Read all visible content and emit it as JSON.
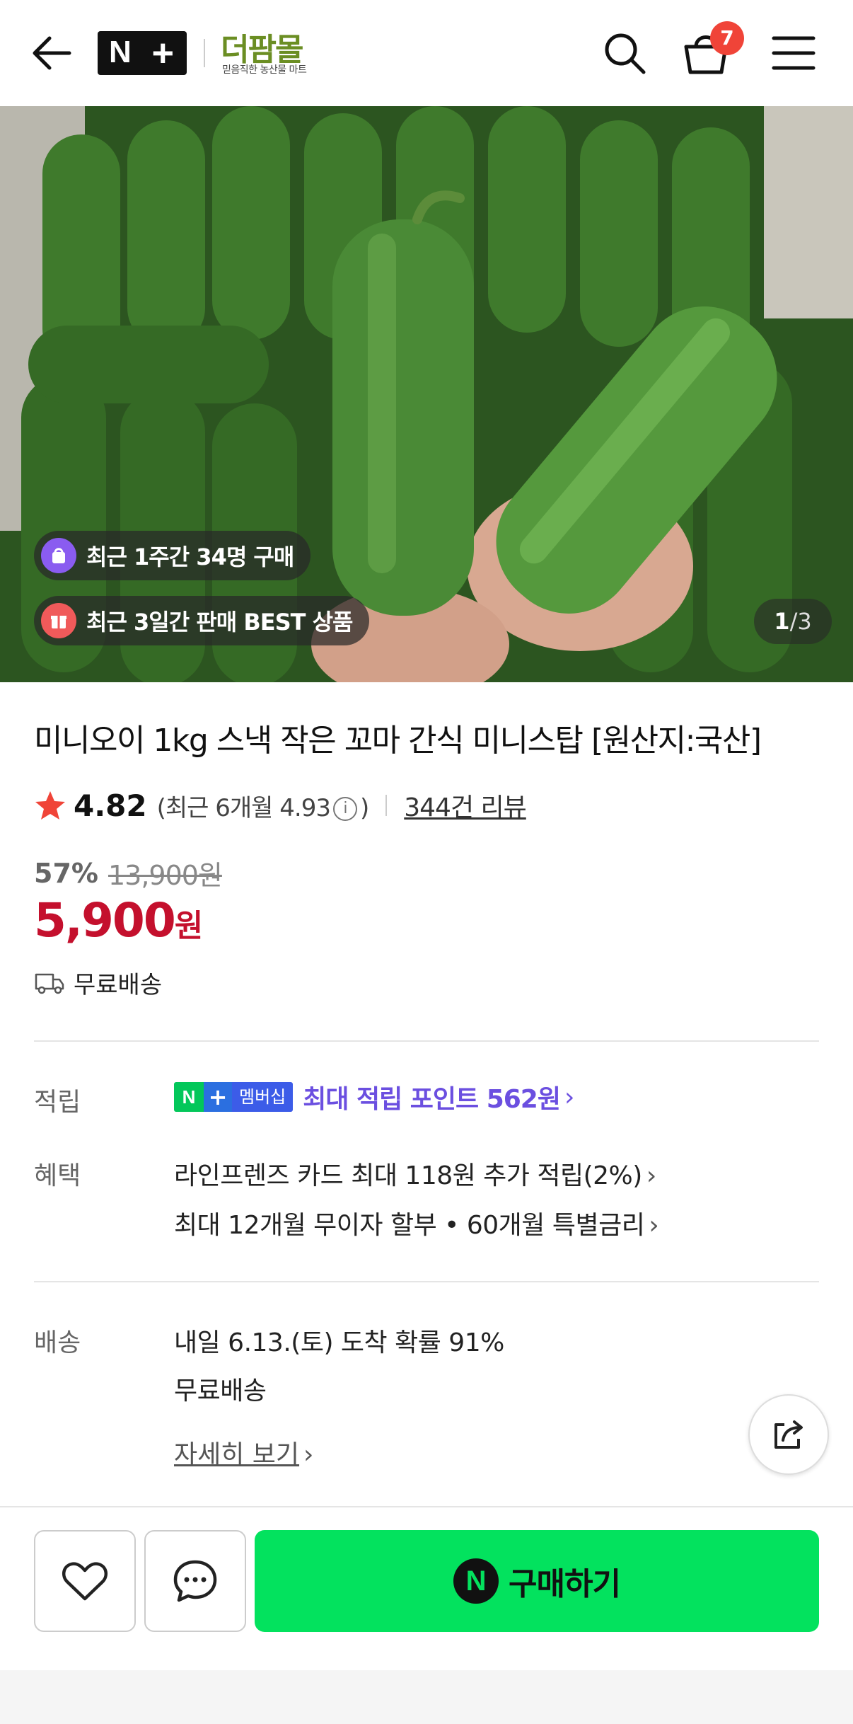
{
  "header": {
    "logo_n": "N",
    "logo_plus": "+",
    "mall_name": "더팜몰",
    "mall_tagline": "믿음직한 농산물 마트",
    "cart_count": "7"
  },
  "hero": {
    "badge_recent_buyers": "최근 1주간 34명 구매",
    "badge_best": "최근 3일간 판매 BEST 상품",
    "image_index": "1",
    "image_total": "/3"
  },
  "product": {
    "title": "미니오이 1kg 스낵 작은 꼬마 간식 미니스탑 [원산지:국산]",
    "rating": "4.82",
    "rating_recent_prefix": "(최근 6개월 4.93",
    "rating_recent_suffix": ")",
    "info_glyph": "i",
    "review_count": "344건 리뷰",
    "discount_percent": "57%",
    "original_price": "13,900원",
    "price": "5,900",
    "price_unit": "원",
    "shipping_summary": "무료배송"
  },
  "benefits": {
    "points_label": "적립",
    "membership_n": "N",
    "membership_plus": "+",
    "membership_text": "멤버십",
    "points_text": "최대 적립 포인트 562원",
    "benefit_label": "혜택",
    "card_benefit": "라인프렌즈 카드 최대 118원 추가 적립(2%)",
    "installment": "최대 12개월 무이자 할부 • 60개월 특별금리",
    "chevron": "›"
  },
  "delivery": {
    "label": "배송",
    "arrival": "내일 6.13.(토) 도착 확률 91%",
    "fee": "무료배송",
    "detail_link": "자세히 보기"
  },
  "bottom": {
    "buy_n": "N",
    "buy_label": "구매하기"
  },
  "colors": {
    "price_red": "#c4102d",
    "buy_green": "#03e25e",
    "points_purple": "#6b4fe0",
    "badge_red": "#f04438"
  },
  "icons": [
    "back-arrow-icon",
    "search-icon",
    "cart-icon",
    "menu-icon",
    "star-icon",
    "info-icon",
    "truck-icon",
    "share-icon",
    "heart-icon",
    "chat-icon"
  ]
}
